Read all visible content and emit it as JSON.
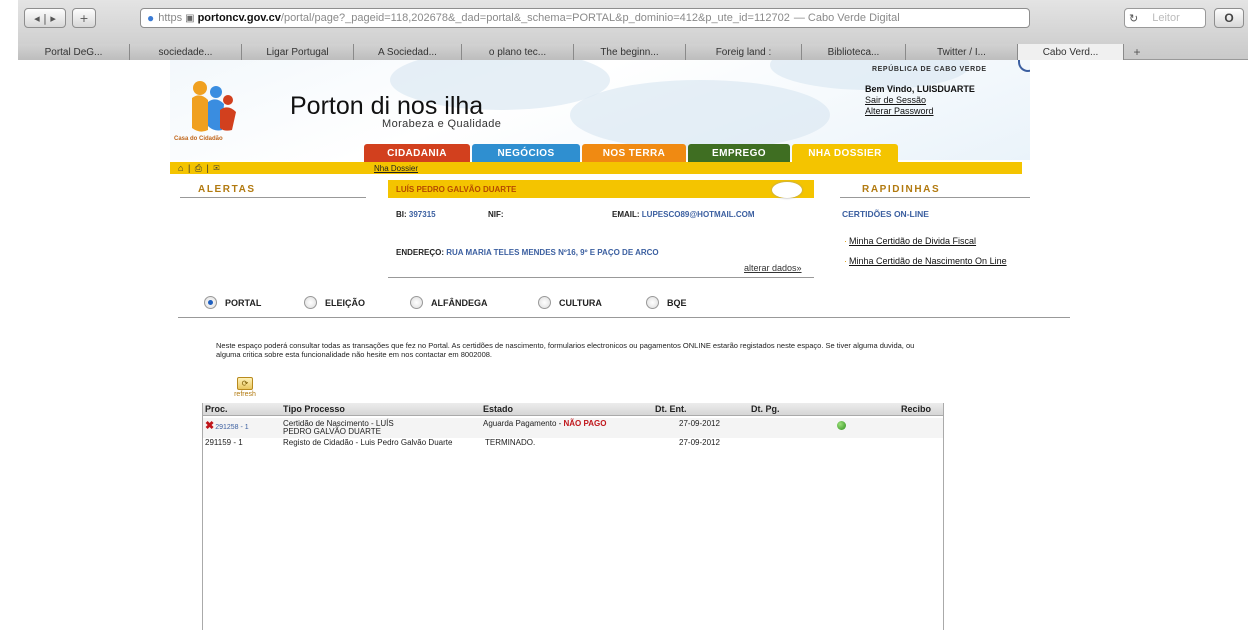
{
  "browser": {
    "url": {
      "protocol": "https",
      "host": "portoncv.gov.cv",
      "path": "/portal/page?_pageid=118,202678&_dad=portal&_schema=PORTAL&p_dominio=412&p_ute_id=112702",
      "page_title": "— Cabo Verde Digital"
    },
    "reader_label": "Leitor",
    "tabs": [
      "Portal DeG...",
      "sociedade...",
      "Ligar Portugal",
      "A Sociedad...",
      "o plano tec...",
      "The beginn...",
      "Foreig land :",
      "Biblioteca...",
      "Twitter / I...",
      "Cabo Verd..."
    ]
  },
  "header": {
    "title": "Porton di nos ilha",
    "subtitle": "Morabeza e Qualidade",
    "logo_caption": "Casa do Cidadão",
    "republica": "REPÚBLICA DE CABO VERDE",
    "welcome": "Bem Vindo, LUISDUARTE",
    "logout": "Sair de Sessão",
    "change_password": "Alterar Password"
  },
  "nav": {
    "tabs": [
      {
        "label": "CIDADANIA",
        "color": "#d2401e"
      },
      {
        "label": "NEGÓCIOS",
        "color": "#2f8fd0"
      },
      {
        "label": "NOS TERRA",
        "color": "#f08a12"
      },
      {
        "label": "EMPREGO",
        "color": "#3f6e22"
      },
      {
        "label": "NHA DOSSIER",
        "color": "#f4c400"
      }
    ],
    "breadcrumb": "Nha Dossier",
    "util_icons": [
      "home-icon",
      "print-icon",
      "mail-icon"
    ]
  },
  "alertas": {
    "title": "ALERTAS"
  },
  "user_card": {
    "name": "LUÍS PEDRO GALVÃO DUARTE",
    "bi_label": "BI:",
    "bi_value": "397315",
    "nif_label": "NIF:",
    "nif_value": "",
    "email_label": "EMAIL:",
    "email_value": "LUPESCO89@HOTMAIL.COM",
    "address_label": "ENDEREÇO:",
    "address_value": "RUA MARIA TELES MENDES Nº16, 9º E PAÇO DE ARCO",
    "edit_link": "alterar dados»"
  },
  "rapidinhas": {
    "title": "RAPIDINHAS",
    "subtitle": "CERTIDÕES ON-LINE",
    "links": [
      "Minha Certidão de Divida Fiscal",
      "Minha Certidão de Nascimento On Line"
    ]
  },
  "radios": {
    "options": [
      {
        "label": "PORTAL",
        "selected": true
      },
      {
        "label": "ELEIÇÃO",
        "selected": false
      },
      {
        "label": "ALFÂNDEGA",
        "selected": false
      },
      {
        "label": "CULTURA",
        "selected": false
      },
      {
        "label": "BQE",
        "selected": false
      }
    ]
  },
  "info_text": "Neste espaço poderá consultar todas as transações que fez no Portal. As certidões de nascimento, formularios electronicos ou pagamentos ONLINE estarão registados neste espaço. Se tiver alguma duvida, ou alguma critica sobre esta funcionalidade não hesite em nos contactar em 8002008.",
  "refresh_label": "refresh",
  "table": {
    "headers": [
      "Proc.",
      "Tipo Processo",
      "Estado",
      "Dt. Ent.",
      "Dt. Pg.",
      "Recibo"
    ],
    "rows": [
      {
        "proc": "291258 - 1",
        "tipo": "Certidão de Nascimento - LUÍS PEDRO GALVÃO DUARTE",
        "estado_prefix": "Aguarda Pagamento - ",
        "estado_status": "NÃO PAGO",
        "dt_ent": "27-09-2012",
        "dt_pg": "",
        "has_delete": true,
        "has_receipt": true
      },
      {
        "proc": "291159 - 1",
        "tipo": "Registo de Cidadão - Luis Pedro Galvão Duarte",
        "estado_prefix": "TERMINADO.",
        "estado_status": "",
        "dt_ent": "27-09-2012",
        "dt_pg": "",
        "has_delete": false,
        "has_receipt": false
      }
    ]
  }
}
